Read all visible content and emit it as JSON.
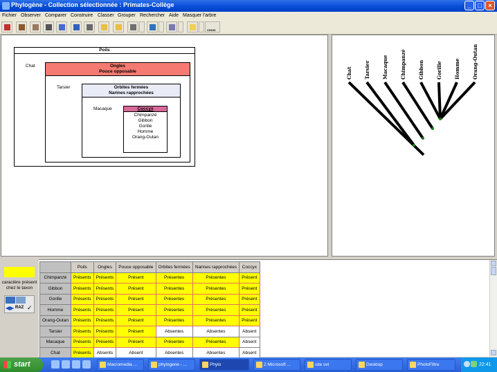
{
  "window": {
    "title": "Phylogène - Collection sélectionnée : Primates-Collège"
  },
  "menu": [
    "Fichier",
    "Observer",
    "Comparer",
    "Construire",
    "Classer",
    "Grouper",
    "Rechercher",
    "Aide",
    "Masquer l'arbre"
  ],
  "toolbar": {
    "choix_label": "CHOIX"
  },
  "classification": {
    "box1": {
      "title": "Poils",
      "outside": "Chat"
    },
    "box2": {
      "title1": "Ongles",
      "title2": "Pouce opposable",
      "outside": "Tarsier"
    },
    "box3": {
      "title1": "Orbites fermées",
      "title2": "Narines rapprochées",
      "outside": "Macaque"
    },
    "box4": {
      "title": "Coccyx",
      "members": [
        "Chimpanzé",
        "Gibbon",
        "Gorille",
        "Homme",
        "Orang-Outan"
      ]
    }
  },
  "tree": {
    "taxa": [
      "Chat",
      "Tarsier",
      "Macaque",
      "Chimpanzé",
      "Gibbon",
      "Gorille",
      "Homme",
      "Orang-Outan"
    ],
    "node_color": "#1a7a1a"
  },
  "legend": {
    "text": "caractère présent chez le taxon",
    "color": "#ffff00",
    "raz_label": "RAZ"
  },
  "table": {
    "columns": [
      "Poils",
      "Ongles",
      "Pouce opposable",
      "Orbites fermées",
      "Narines rapprochées",
      "Coccyx"
    ],
    "rows": [
      {
        "name": "Chimpanzé",
        "cells": [
          "Présents",
          "Présents",
          "Présent",
          "Présentes",
          "Présentes",
          "Présent"
        ],
        "present": [
          true,
          true,
          true,
          true,
          true,
          true
        ]
      },
      {
        "name": "Gibbon",
        "cells": [
          "Présents",
          "Présents",
          "Présent",
          "Présentes",
          "Présentes",
          "Présent"
        ],
        "present": [
          true,
          true,
          true,
          true,
          true,
          true
        ]
      },
      {
        "name": "Gorille",
        "cells": [
          "Présents",
          "Présents",
          "Présent",
          "Présentes",
          "Présentes",
          "Présent"
        ],
        "present": [
          true,
          true,
          true,
          true,
          true,
          true
        ]
      },
      {
        "name": "Homme",
        "cells": [
          "Présents",
          "Présents",
          "Présent",
          "Présentes",
          "Présentes",
          "Présent"
        ],
        "present": [
          true,
          true,
          true,
          true,
          true,
          true
        ]
      },
      {
        "name": "Orang-Outan",
        "cells": [
          "Présents",
          "Présents",
          "Présent",
          "Présentes",
          "Présentes",
          "Présent"
        ],
        "present": [
          true,
          true,
          true,
          true,
          true,
          true
        ]
      },
      {
        "name": "Tarsier",
        "cells": [
          "Présents",
          "Présents",
          "Présent",
          "Absentes",
          "Absentes",
          "Absent"
        ],
        "present": [
          true,
          true,
          true,
          false,
          false,
          false
        ]
      },
      {
        "name": "Macaque",
        "cells": [
          "Présents",
          "Présents",
          "Présent",
          "Présentes",
          "Présentes",
          "Absent"
        ],
        "present": [
          true,
          true,
          true,
          true,
          true,
          false
        ]
      },
      {
        "name": "Chat",
        "cells": [
          "Présents",
          "Absents",
          "Absent",
          "Absentes",
          "Absentes",
          "Absent"
        ],
        "present": [
          true,
          false,
          false,
          false,
          false,
          false
        ]
      }
    ]
  },
  "taskbar": {
    "start": "start",
    "buttons": [
      "Macromedia ...",
      "phylogene - ...",
      "Phylo",
      "2 Microsoft ...",
      "site svt",
      "Desktop",
      "PhotoFiltre"
    ],
    "active_index": 2,
    "clock": "22:41"
  }
}
